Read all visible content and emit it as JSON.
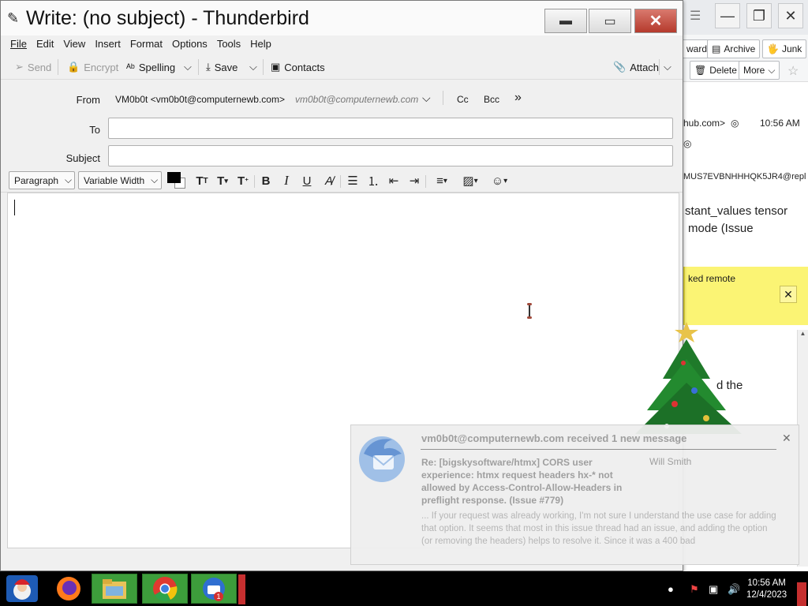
{
  "compose_window": {
    "title": "Write: (no subject) - Thunderbird",
    "menu": [
      "File",
      "Edit",
      "View",
      "Insert",
      "Format",
      "Options",
      "Tools",
      "Help"
    ],
    "toolbar": {
      "send": "Send",
      "encrypt": "Encrypt",
      "spelling": "Spelling",
      "save": "Save",
      "contacts": "Contacts",
      "attach": "Attach"
    },
    "header": {
      "from_label": "From",
      "from_value": "VM0b0t <vm0b0t@computernewb.com>",
      "from_hint": "vm0b0t@computernewb.com",
      "cc": "Cc",
      "bcc": "Bcc",
      "more": "»",
      "to_label": "To",
      "to_value": "",
      "subject_label": "Subject",
      "subject_value": ""
    },
    "format": {
      "paragraph": "Paragraph",
      "font": "Variable Width",
      "text_color": "#000000"
    }
  },
  "background_window": {
    "toolbar": {
      "forward": "ward",
      "archive": "Archive",
      "junk": "Junk",
      "delete": "Delete",
      "more": "More"
    },
    "from_partial": "hub.com>",
    "time": "10:56 AM",
    "msgid_partial": "MUS7EVBNHHHQK5JR4@repl",
    "subject_line1": "stant_values tensor",
    "subject_line2": "mode (Issue",
    "remote_content": "ked remote",
    "body_partial": "d the",
    "colors": {
      "notice": "#fbf474"
    }
  },
  "notification": {
    "heading": "vm0b0t@computernewb.com received 1 new message",
    "subject": "Re: [bigskysoftware/htmx] CORS user experience: htmx request headers hx-* not allowed by Access-Control-Allow-Headers in preflight response. (Issue #779)",
    "sender": "Will Smith",
    "preview": "... If your request was already working, I'm not sure I understand the use case for adding that option. It seems that most in this issue thread had an issue, and adding the option (or removing the headers) helps to resolve it. Since it was a 400 bad"
  },
  "taskbar": {
    "time": "10:56 AM",
    "date": "12/4/2023",
    "badge": "1"
  }
}
